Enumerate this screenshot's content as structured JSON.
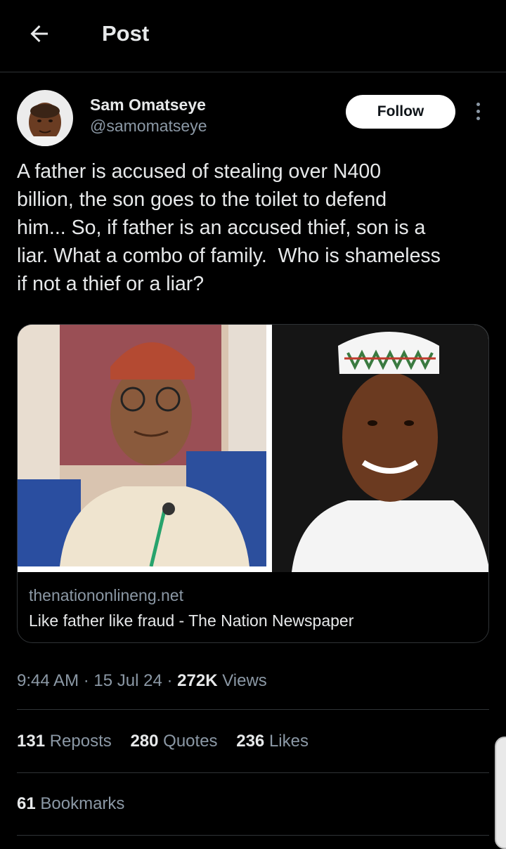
{
  "header": {
    "title": "Post",
    "back_icon": "arrow-left-icon"
  },
  "author": {
    "display_name": "Sam Omatseye",
    "handle": "@samomatseye",
    "follow_label": "Follow",
    "more_icon": "more-vertical-icon"
  },
  "tweet": {
    "text": "A father is accused of stealing over N400\nbillion, the son goes to the toilet to defend\nhim... So, if father is an accused thief, son is a\nliar. What a combo of family.  Who is shameless\nif not a thief or a liar?"
  },
  "card": {
    "domain": "thenationonlineng.net",
    "title": "Like father like fraud - The Nation Newspaper"
  },
  "meta": {
    "time": "9:44 AM",
    "separator": "·",
    "date": "15 Jul 24",
    "views_count": "272K",
    "views_label": "Views"
  },
  "stats": {
    "reposts_count": "131",
    "reposts_label": "Reposts",
    "quotes_count": "280",
    "quotes_label": "Quotes",
    "likes_count": "236",
    "likes_label": "Likes",
    "bookmarks_count": "61",
    "bookmarks_label": "Bookmarks"
  },
  "colors": {
    "background": "#000000",
    "text": "#e7e9ea",
    "secondary_text": "#8b98a5",
    "divider": "#2f3336",
    "follow_bg": "#ffffff"
  }
}
